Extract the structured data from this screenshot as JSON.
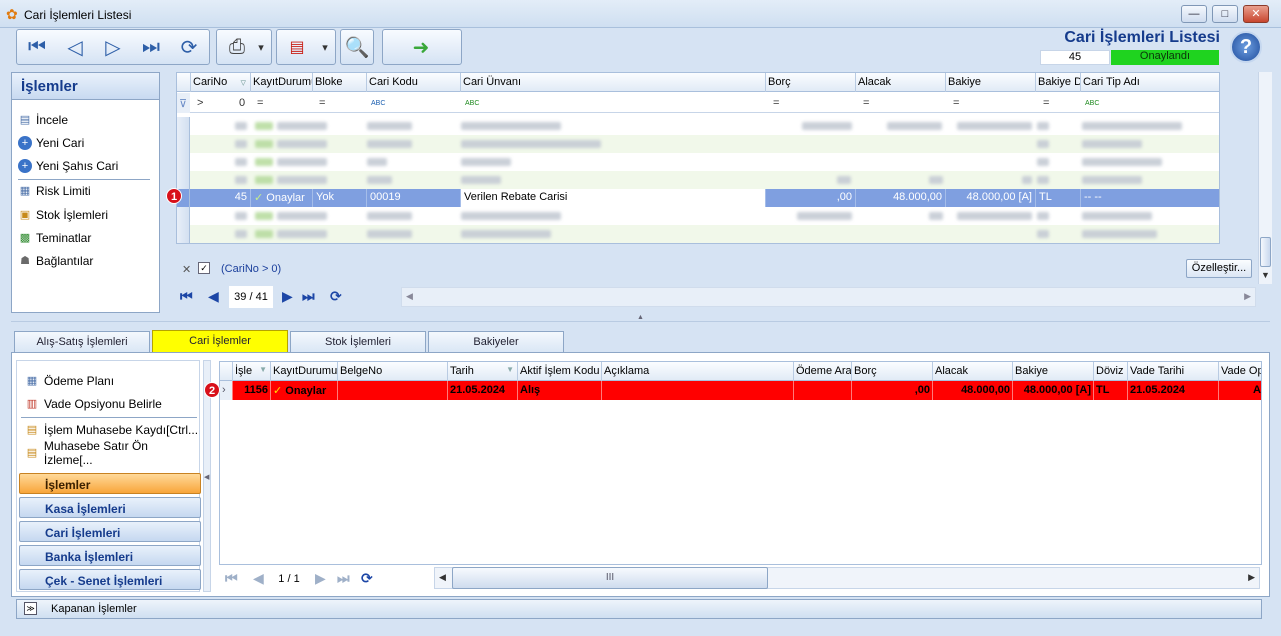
{
  "window": {
    "title": "Cari İşlemleri Listesi",
    "min": "—",
    "max": "□",
    "close": "✕"
  },
  "header": {
    "title": "Cari İşlemleri Listesi",
    "count": "45",
    "status": "Onaylandı",
    "status_color": "#1fd31f",
    "help": "?"
  },
  "toolbar": {
    "icons": [
      "first-record-icon",
      "previous-record-icon",
      "next-record-icon",
      "last-record-icon",
      "refresh-icon",
      "print-icon",
      "dropdown-arrow-icon",
      "pdf-export-icon",
      "dropdown-arrow-icon",
      "report-design-icon",
      "exit-door-icon"
    ],
    "dropdown": "▾"
  },
  "left_panel": {
    "title": "İşlemler",
    "items": [
      {
        "label": "İncele",
        "icon": "document-icon"
      },
      {
        "label": "Yeni Cari",
        "icon": "add-circle-icon"
      },
      {
        "label": "Yeni Şahıs Cari",
        "icon": "add-circle-icon"
      },
      {
        "label": "Risk Limiti",
        "icon": "chart-icon"
      },
      {
        "label": "Stok İşlemleri",
        "icon": "boxes-icon"
      },
      {
        "label": "Teminatlar",
        "icon": "money-icon"
      },
      {
        "label": "Bağlantılar",
        "icon": "users-icon"
      }
    ]
  },
  "grid1": {
    "columns": [
      "CariNo",
      "KayıtDurumu",
      "Bloke",
      "Cari Kodu",
      "Cari Ünvanı",
      "Borç",
      "Alacak",
      "Bakiye",
      "Bakiye D",
      "Cari Tip Adı"
    ],
    "filter": {
      "cari_no_op": ">",
      "cari_no": "0",
      "eq": "=",
      "text": "ABC",
      "sort_marker": "⊽"
    },
    "selected_row": {
      "cari_no": "45",
      "kayit_durumu": "Onaylar",
      "check": "✓",
      "bloke": "Yok",
      "cari_kodu": "00019",
      "cari_unvani": "Verilen Rebate Carisi",
      "borc": ",00",
      "alacak": "48.000,00",
      "bakiye": "48.000,00 [A]",
      "bakiye_d": "TL",
      "cari_tip": "-- --"
    },
    "filter_text": "(CariNo > 0)",
    "filter_close": "✕",
    "filter_checkbox": "✓",
    "customize_button": "Özelleştir...",
    "pager": "39 / 41",
    "badge": "1"
  },
  "tabs": [
    {
      "label": "Alış-Satış İşlemleri",
      "active": false
    },
    {
      "label": "Cari İşlemler",
      "active": true
    },
    {
      "label": "Stok İşlemleri",
      "active": false
    },
    {
      "label": "Bakiyeler",
      "active": false
    }
  ],
  "actions_panel": {
    "items": [
      {
        "label": "Ödeme Planı",
        "icon": "calculator-icon"
      },
      {
        "label": "Vade Opsiyonu Belirle",
        "icon": "calendar-icon"
      },
      {
        "label": "İşlem Muhasebe Kaydı[Ctrl...",
        "icon": "ledger-icon"
      },
      {
        "label": "Muhasebe Satır Ön İzleme[...",
        "icon": "ledger-preview-icon"
      }
    ],
    "nav_groups": [
      {
        "label": "İşlemler",
        "active": true
      },
      {
        "label": "Kasa İşlemleri",
        "active": false
      },
      {
        "label": "Cari İşlemleri",
        "active": false
      },
      {
        "label": "Banka İşlemleri",
        "active": false
      },
      {
        "label": "Çek - Senet İşlemleri",
        "active": false
      }
    ]
  },
  "grid2": {
    "columns": [
      "İşle",
      "KayıtDurumu",
      "BelgeNo",
      "Tarih",
      "Aktif İşlem Kodu",
      "Açıklama",
      "Ödeme Ara",
      "Borç",
      "Alacak",
      "Bakiye",
      "Döviz",
      "Vade Tarihi",
      "Vade Op"
    ],
    "row": {
      "isle": "1156",
      "check": "✓",
      "kayit_durumu": "Onaylar",
      "belge_no": "",
      "tarih": "21.05.2024",
      "aktif_islem_kodu": "Alış",
      "aciklama": "",
      "odeme_ara": "",
      "borc": ",00",
      "alacak": "48.000,00",
      "bakiye": "48.000,00 [A]",
      "doviz": "TL",
      "vade_tarihi": "21.05.2024",
      "vade_op": "A"
    },
    "row_color": "#ff0000",
    "pager": "1 / 1",
    "scroll_grip": "III",
    "badge": "2"
  },
  "closed_bar": {
    "label": "Kapanan İşlemler",
    "icon": "≫"
  }
}
